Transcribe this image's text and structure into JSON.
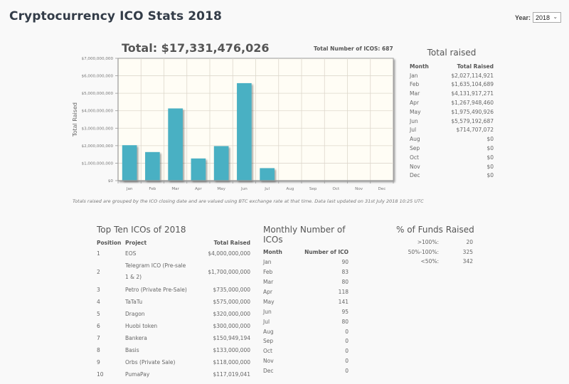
{
  "header": {
    "title": "Cryptocurrency ICO Stats 2018",
    "year_label": "Year:",
    "year_selected": "2018"
  },
  "chart_summary": {
    "total": "Total: $17,331,476,026",
    "count": "Total Number of ICOS: 687",
    "note": "Totals raised are grouped by the ICO closing date and are valued using BTC exchange rate at that time. Data last updated on 31st July 2018 10:25 UTC"
  },
  "chart_data": {
    "type": "bar",
    "title": "Total: $17,331,476,026",
    "xlabel": "",
    "ylabel": "Total Raised",
    "categories": [
      "Jan",
      "Feb",
      "Mar",
      "Apr",
      "May",
      "Jun",
      "Jul",
      "Aug",
      "Sep",
      "Oct",
      "Nov",
      "Dec"
    ],
    "values": [
      2027114921,
      1635104689,
      4131917271,
      1267948460,
      1975490926,
      5579192687,
      714707072,
      0,
      0,
      0,
      0,
      0
    ],
    "ylim": [
      0,
      7000000000
    ],
    "yticks": [
      0,
      1000000000,
      2000000000,
      3000000000,
      4000000000,
      5000000000,
      6000000000,
      7000000000
    ],
    "ytick_labels": [
      "$0",
      "$1,000,000,000",
      "$2,000,000,000",
      "$3,000,000,000",
      "$4,000,000,000",
      "$5,000,000,000",
      "$6,000,000,000",
      "$7,000,000,000"
    ],
    "grid": true,
    "legend": "none",
    "colors": {
      "bar": "#4ab0c3",
      "plot_bg": "#fffdf5",
      "grid": "#ddd8cc",
      "axis": "#999999"
    }
  },
  "total_raised": {
    "title": "Total raised",
    "headers": [
      "Month",
      "Total Raised"
    ],
    "rows": [
      [
        "Jan",
        "$2,027,114,921"
      ],
      [
        "Feb",
        "$1,635,104,689"
      ],
      [
        "Mar",
        "$4,131,917,271"
      ],
      [
        "Apr",
        "$1,267,948,460"
      ],
      [
        "May",
        "$1,975,490,926"
      ],
      [
        "Jun",
        "$5,579,192,687"
      ],
      [
        "Jul",
        "$714,707,072"
      ],
      [
        "Aug",
        "$0"
      ],
      [
        "Sep",
        "$0"
      ],
      [
        "Oct",
        "$0"
      ],
      [
        "Nov",
        "$0"
      ],
      [
        "Dec",
        "$0"
      ]
    ]
  },
  "top_ten": {
    "title": "Top Ten ICOs of 2018",
    "headers": [
      "Position",
      "Project",
      "Total Raised"
    ],
    "rows": [
      [
        "1",
        "EOS",
        "$4,000,000,000"
      ],
      [
        "2",
        "Telegram ICO (Pre-sale 1 & 2)",
        "$1,700,000,000"
      ],
      [
        "3",
        "Petro (Private Pre-Sale)",
        "$735,000,000"
      ],
      [
        "4",
        "TaTaTu",
        "$575,000,000"
      ],
      [
        "5",
        "Dragon",
        "$320,000,000"
      ],
      [
        "6",
        "Huobi token",
        "$300,000,000"
      ],
      [
        "7",
        "Bankera",
        "$150,949,194"
      ],
      [
        "8",
        "Basis",
        "$133,000,000"
      ],
      [
        "9",
        "Orbs (Private Sale)",
        "$118,000,000"
      ],
      [
        "10",
        "PumaPay",
        "$117,019,041"
      ]
    ]
  },
  "monthly_count": {
    "title": "Monthly Number of ICOs",
    "headers": [
      "Month",
      "Number of ICO"
    ],
    "rows": [
      [
        "Jan",
        "90"
      ],
      [
        "Feb",
        "83"
      ],
      [
        "Mar",
        "80"
      ],
      [
        "Apr",
        "118"
      ],
      [
        "May",
        "141"
      ],
      [
        "Jun",
        "95"
      ],
      [
        "Jul",
        "80"
      ],
      [
        "Aug",
        "0"
      ],
      [
        "Sep",
        "0"
      ],
      [
        "Oct",
        "0"
      ],
      [
        "Nov",
        "0"
      ],
      [
        "Dec",
        "0"
      ]
    ]
  },
  "funds_raised": {
    "title": "% of Funds Raised",
    "rows": [
      [
        ">100%:",
        "20"
      ],
      [
        "50%-100%:",
        "325"
      ],
      [
        "<50%:",
        "342"
      ]
    ]
  }
}
